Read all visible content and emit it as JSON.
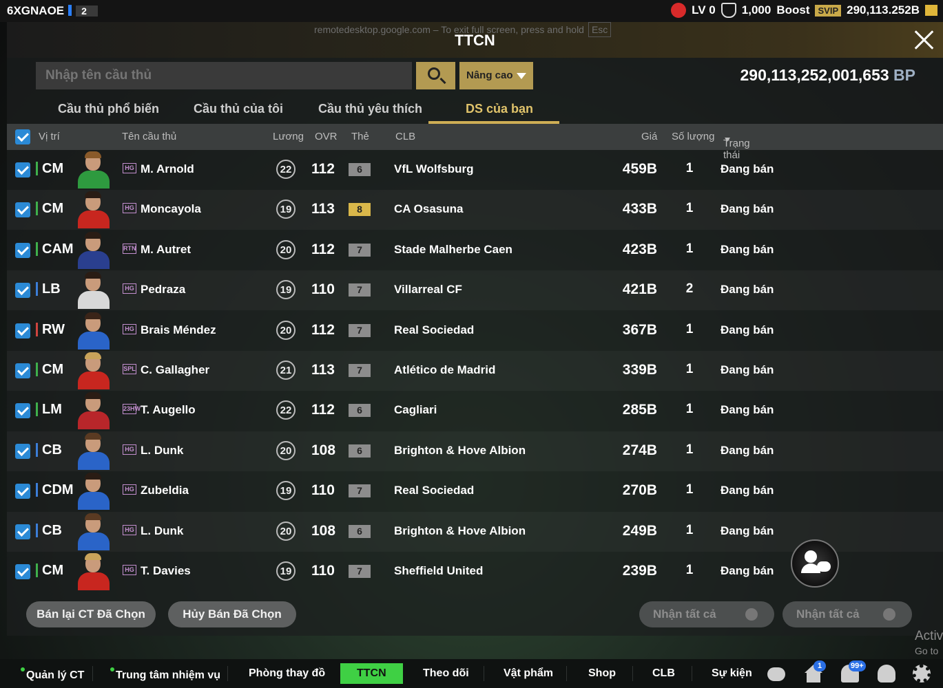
{
  "topbar": {
    "account_id": "6XGNAOE",
    "account_num": "2",
    "level": "LV 0",
    "points": "1,000",
    "boost": "Boost",
    "svip": "SVIP",
    "balance_short": "290,113.252B"
  },
  "header": {
    "remote_message": "remotedesktop.google.com – To exit full screen, press and hold",
    "remote_key": "Esc",
    "title": "TTCN"
  },
  "search": {
    "placeholder": "Nhập tên cầu thủ",
    "advanced_label": "Nâng cao",
    "bp_amount": "290,113,252,001,653",
    "bp_unit": "BP"
  },
  "tabs": [
    "Cầu thủ phổ biến",
    "Cầu thủ của tôi",
    "Cầu thủ yêu thích",
    "DS của bạn"
  ],
  "columns": {
    "position": "Vị trí",
    "name": "Tên cầu thủ",
    "salary": "Lương",
    "ovr": "OVR",
    "grade": "Thẻ",
    "club": "CLB",
    "price": "Giá",
    "quantity": "Số lượng",
    "status": "Trạng thái"
  },
  "rows": [
    {
      "position": "CM",
      "season": "HG",
      "name": "M. Arnold",
      "salary": "22",
      "ovr": "112",
      "grade": "6",
      "club": "VfL Wolfsburg",
      "price": "459B",
      "qty": "1",
      "status": "Đang bán"
    },
    {
      "position": "CM",
      "season": "HG",
      "name": "Moncayola",
      "salary": "19",
      "ovr": "113",
      "grade": "8",
      "club": "CA Osasuna",
      "price": "433B",
      "qty": "1",
      "status": "Đang bán"
    },
    {
      "position": "CAM",
      "season": "RTN",
      "name": "M. Autret",
      "salary": "20",
      "ovr": "112",
      "grade": "7",
      "club": "Stade Malherbe Caen",
      "price": "423B",
      "qty": "1",
      "status": "Đang bán"
    },
    {
      "position": "LB",
      "season": "HG",
      "name": "Pedraza",
      "salary": "19",
      "ovr": "110",
      "grade": "7",
      "club": "Villarreal CF",
      "price": "421B",
      "qty": "2",
      "status": "Đang bán"
    },
    {
      "position": "RW",
      "season": "HG",
      "name": "Brais Méndez",
      "salary": "20",
      "ovr": "112",
      "grade": "7",
      "club": "Real Sociedad",
      "price": "367B",
      "qty": "1",
      "status": "Đang bán"
    },
    {
      "position": "CM",
      "season": "SPL",
      "name": "C. Gallagher",
      "salary": "21",
      "ovr": "113",
      "grade": "7",
      "club": "Atlético de Madrid",
      "price": "339B",
      "qty": "1",
      "status": "Đang bán"
    },
    {
      "position": "LM",
      "season": "23HW",
      "name": "T. Augello",
      "salary": "22",
      "ovr": "112",
      "grade": "6",
      "club": "Cagliari",
      "price": "285B",
      "qty": "1",
      "status": "Đang bán"
    },
    {
      "position": "CB",
      "season": "HG",
      "name": "L. Dunk",
      "salary": "20",
      "ovr": "108",
      "grade": "6",
      "club": "Brighton & Hove Albion",
      "price": "274B",
      "qty": "1",
      "status": "Đang bán"
    },
    {
      "position": "CDM",
      "season": "HG",
      "name": "Zubeldia",
      "salary": "19",
      "ovr": "110",
      "grade": "7",
      "club": "Real Sociedad",
      "price": "270B",
      "qty": "1",
      "status": "Đang bán"
    },
    {
      "position": "CB",
      "season": "HG",
      "name": "L. Dunk",
      "salary": "20",
      "ovr": "108",
      "grade": "6",
      "club": "Brighton & Hove Albion",
      "price": "249B",
      "qty": "1",
      "status": "Đang bán"
    },
    {
      "position": "CM",
      "season": "HG",
      "name": "T. Davies",
      "salary": "19",
      "ovr": "110",
      "grade": "7",
      "club": "Sheffield United",
      "price": "239B",
      "qty": "1",
      "status": "Đang bán"
    }
  ],
  "actions": {
    "resell_selected": "Bán lại CT Đã Chọn",
    "cancel_selected": "Hủy Bán Đã Chọn",
    "claim_all_1": "Nhận tất cả",
    "claim_all_2": "Nhận tất cả"
  },
  "nav": {
    "items": [
      "Quản lý CT",
      "Trung tâm nhiệm vụ",
      "Phòng thay đồ",
      "TTCN",
      "Theo dõi",
      "Vật phẩm",
      "Shop",
      "CLB",
      "Sự kiện"
    ],
    "home_badge": "1",
    "bell_badge": "99+"
  },
  "watermark": {
    "line1": "Activ",
    "line2": "Go to"
  },
  "colors": {
    "accent_gold": "#b39a52",
    "active_tab": "#e0c36b",
    "nav_active": "#3fd044",
    "checkbox": "#2b8ad6"
  }
}
